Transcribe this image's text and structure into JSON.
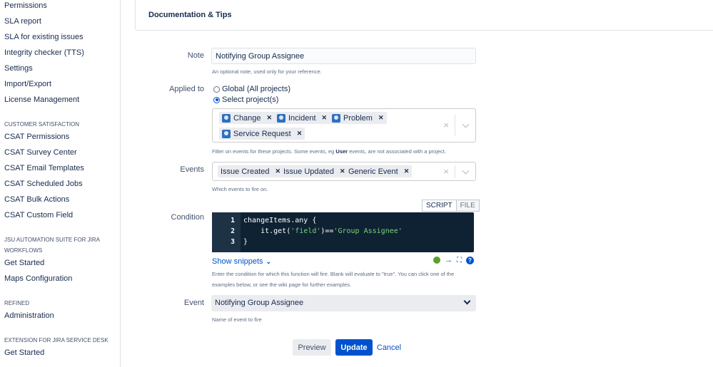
{
  "sidebar": {
    "items": [
      {
        "type": "link",
        "label": "Permissions"
      },
      {
        "type": "link",
        "label": "SLA report"
      },
      {
        "type": "link",
        "label": "SLA for existing issues"
      },
      {
        "type": "link",
        "label": "Integrity checker (TTS)"
      },
      {
        "type": "link",
        "label": "Settings"
      },
      {
        "type": "link",
        "label": "Import/Export"
      },
      {
        "type": "link",
        "label": "License Management"
      },
      {
        "type": "heading",
        "label": "CUSTOMER SATISFACTION"
      },
      {
        "type": "link",
        "label": "CSAT Permissions"
      },
      {
        "type": "link",
        "label": "CSAT Survey Center"
      },
      {
        "type": "link",
        "label": "CSAT Email Templates"
      },
      {
        "type": "link",
        "label": "CSAT Scheduled Jobs"
      },
      {
        "type": "link",
        "label": "CSAT Bulk Actions"
      },
      {
        "type": "link",
        "label": "CSAT Custom Field"
      },
      {
        "type": "heading",
        "label": "JSU AUTOMATION SUITE FOR JIRA WORKFLOWS"
      },
      {
        "type": "link",
        "label": "Get Started"
      },
      {
        "type": "link",
        "label": "Maps Configuration"
      },
      {
        "type": "heading",
        "label": "REFINED"
      },
      {
        "type": "link",
        "label": "Administration"
      },
      {
        "type": "heading",
        "label": "EXTENSION FOR JIRA SERVICE DESK"
      },
      {
        "type": "link",
        "label": "Get Started"
      }
    ]
  },
  "panel": {
    "title": "Documentation & Tips"
  },
  "form": {
    "note": {
      "label": "Note",
      "value": "Notifying Group Assignee",
      "help": "An optional note, used only for your reference."
    },
    "applied_to": {
      "label": "Applied to",
      "options": [
        "Global (All projects)",
        "Select project(s)"
      ],
      "selected": "Select project(s)",
      "projects": [
        "Change",
        "Incident",
        "Problem",
        "Service Request"
      ],
      "help_pre": "Filter on events for these projects. Some events, eg ",
      "help_bold": "User",
      "help_post": " events, are not associated with a project.",
      "clear": "×"
    },
    "events": {
      "label": "Events",
      "values": [
        "Issue Created",
        "Issue Updated",
        "Generic Event"
      ],
      "help": "Which events to fire on.",
      "clear": "×"
    },
    "condition": {
      "label": "Condition",
      "tabs": [
        "SCRIPT",
        "FILE"
      ],
      "active_tab": "SCRIPT",
      "code_lines": [
        {
          "num": "1",
          "pre": "changeItems.any {",
          "str": "",
          "post": ""
        },
        {
          "num": "2",
          "pre": "    it.get(",
          "str": "'field'",
          "mid": ")==",
          "str2": "'Group Assignee'"
        },
        {
          "num": "3",
          "pre": "}",
          "str": "",
          "post": ""
        }
      ],
      "snippets_label": "Show snippets",
      "help_line1": "Enter the condition for which this function will fire. Blank will evaluate to \"true\". You can click one of the",
      "help_line2": "examples below, or see the wiki page for further examples.",
      "tool_icons": [
        "status-ok-icon",
        "run-arrow-icon",
        "fullscreen-icon",
        "help-icon"
      ]
    },
    "event": {
      "label": "Event",
      "value": "Notifying Group Assignee",
      "help": "Name of event to fire"
    }
  },
  "actions": {
    "preview": "Preview",
    "update": "Update",
    "cancel": "Cancel"
  },
  "colors": {
    "primary": "#0052cc",
    "code_bg": "#0e2233",
    "code_string": "#7ed07b"
  }
}
